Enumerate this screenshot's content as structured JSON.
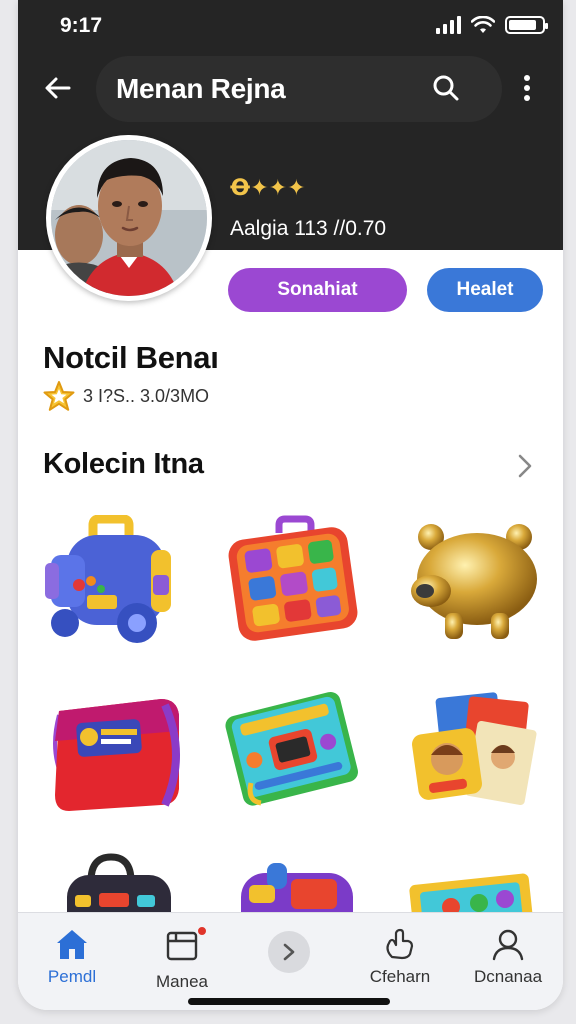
{
  "status_bar": {
    "time": "9:17"
  },
  "header": {
    "title": "Menan Rejna",
    "icons": {
      "back": "arrow-left-icon",
      "search": "search-icon",
      "more": "more-vertical-icon"
    }
  },
  "profile": {
    "badges": "Ꝋ✦✦✦",
    "stats": "Aalgia 113 //0.70",
    "primary_button": "Sonahiat",
    "secondary_button": "Healet",
    "name": "Notcil Benaı",
    "rating": "3 I?S.. 3.0/3MO"
  },
  "collection": {
    "title": "Kolecin Itna",
    "items": [
      {
        "name": "blue-toy-backpack"
      },
      {
        "name": "activity-board-toy"
      },
      {
        "name": "gold-bear-figure"
      },
      {
        "name": "red-pencil-case"
      },
      {
        "name": "colorful-book-toy"
      },
      {
        "name": "picture-book-set"
      },
      {
        "name": "black-bag"
      },
      {
        "name": "purple-bag"
      },
      {
        "name": "puzzle-box"
      }
    ]
  },
  "bottom_nav": {
    "items": [
      {
        "label": "Pemdl",
        "icon": "home-icon",
        "active": true
      },
      {
        "label": "Manea",
        "icon": "inbox-icon",
        "active": false
      },
      {
        "label": "",
        "icon": "chevron-right-icon",
        "active": false
      },
      {
        "label": "Cfeharn",
        "icon": "hand-icon",
        "active": false
      },
      {
        "label": "Dcnanaa",
        "icon": "user-icon",
        "active": false
      }
    ]
  },
  "colors": {
    "header_bg": "#252525",
    "accent_purple": "#9b48d2",
    "accent_blue": "#3a78d8",
    "active_nav": "#2c6fd6",
    "star": "#f2c44a"
  }
}
